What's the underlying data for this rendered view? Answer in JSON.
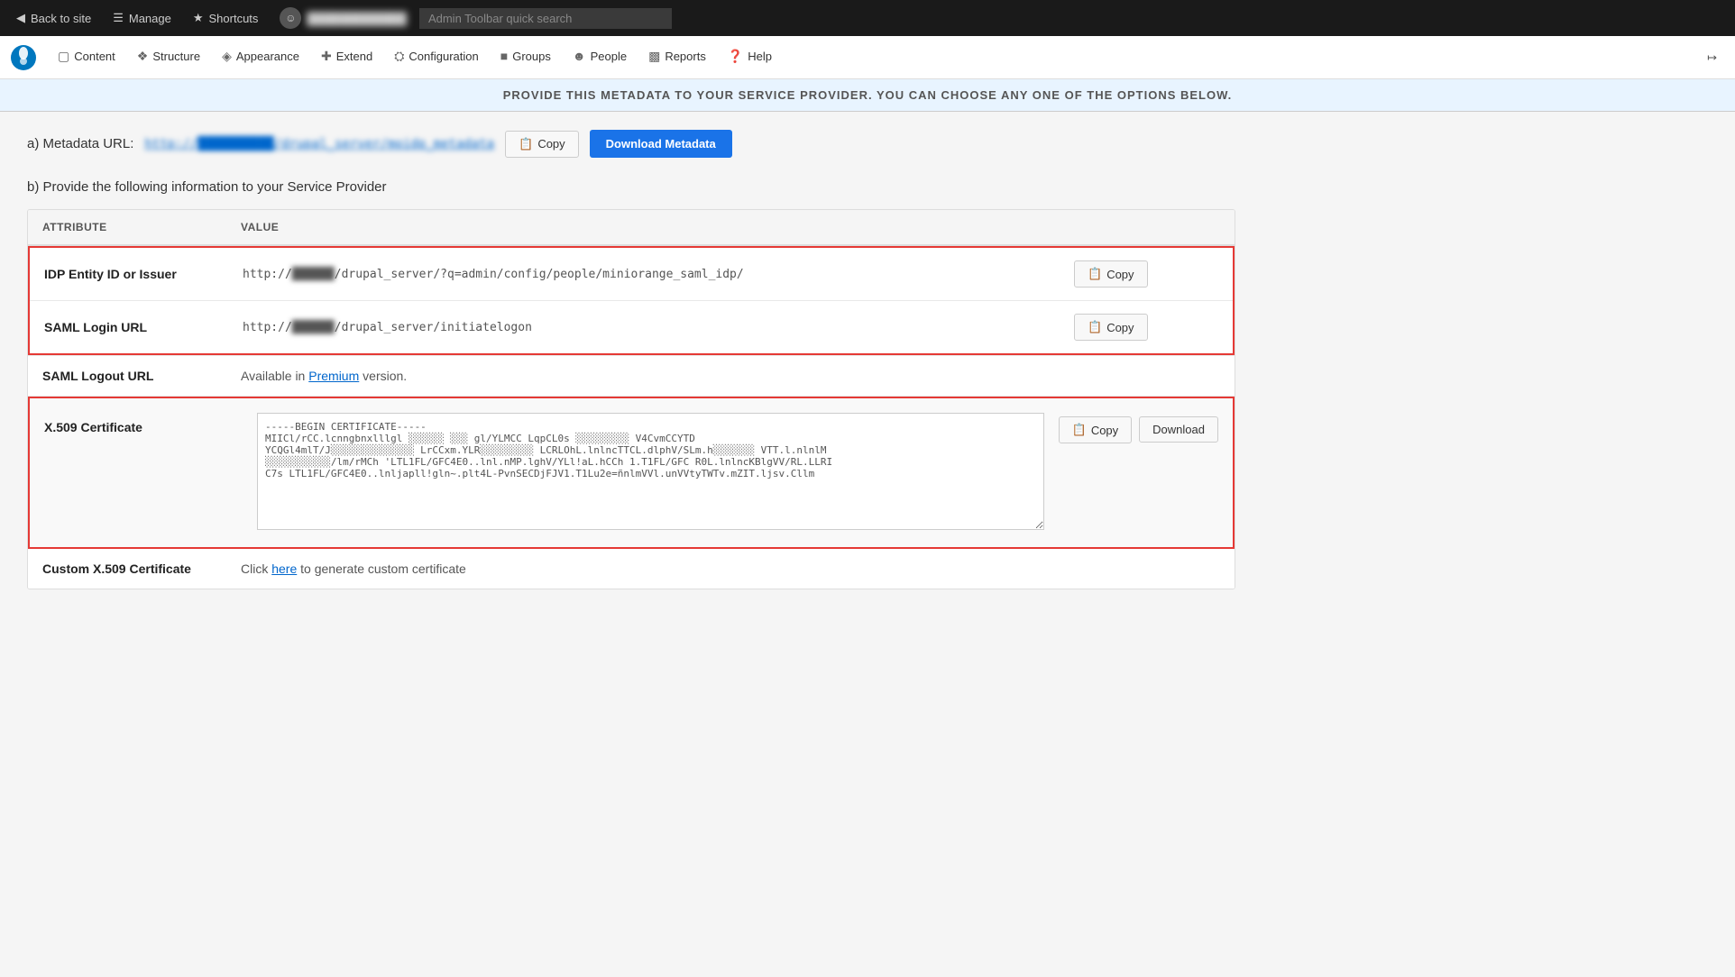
{
  "toolbar": {
    "back_to_site": "Back to site",
    "manage": "Manage",
    "shortcuts": "Shortcuts",
    "user_name": "████████████",
    "search_placeholder": "Admin Toolbar quick search"
  },
  "nav": {
    "content": "Content",
    "structure": "Structure",
    "appearance": "Appearance",
    "extend": "Extend",
    "configuration": "Configuration",
    "groups": "Groups",
    "people": "People",
    "reports": "Reports",
    "help": "Help"
  },
  "banner": {
    "text": "PROVIDE THIS METADATA TO YOUR SERVICE PROVIDER. YOU CAN CHOOSE ANY ONE OF THE OPTIONS BELOW."
  },
  "metadata_section": {
    "label": "a) Metadata URL:",
    "url": "http://██████████/drupal_server/moidp_metadata",
    "copy_btn": "Copy",
    "download_btn": "Download Metadata"
  },
  "section_b": {
    "label": "b) Provide the following information to your Service Provider"
  },
  "table": {
    "col_attribute": "ATTRIBUTE",
    "col_value": "VALUE",
    "rows": [
      {
        "attribute": "IDP Entity ID or Issuer",
        "value": "http://██████/drupal_server/?q=admin/config/people/miniorange_saml_idp/",
        "copy_btn": "Copy",
        "highlight": true
      },
      {
        "attribute": "SAML Login URL",
        "value": "http://██████/drupal_server/initiatelogon",
        "copy_btn": "Copy",
        "highlight": true
      }
    ]
  },
  "logout_row": {
    "attribute": "SAML Logout URL",
    "value_prefix": "Available in ",
    "value_link": "Premium",
    "value_suffix": " version."
  },
  "certificate": {
    "attribute": "X.509 Certificate",
    "content_lines": [
      "-----BEGIN CERTIFICATE-----",
      "MIICl/rCC.lcnngbnxlllgl ░░░░░░░░░ ░░░ gl/YLMCC LqpCL0s ░░░░░░░░░░ V4Cvm CCYT D",
      "YCQGl4mlT /J ░░░░░░░░░░ LrCCxm.YLR ░░░░░░░░░ LCRLOhL.lnlncT TCL.d lphV/SLm.h░░░░░░░ VTT.l.nlnlM",
      "░░░░░░░ /lm/rMCh 'L T L1FL/G F C4E0..ln l.nMP. lghV/YL l!aL.hCCh 1.T1FL/G FCR0L.lnlncKBlgVV/RL.LLRI",
      "C7s L T L1FL/G F C4E0..lnljapll!gln~.plt4L-PvnSECDjFJV1.T1Lu2e=ñnlmVVl.unVVtyTWTv.mZIT.ljsv.Cllm"
    ],
    "copy_btn": "Copy",
    "download_btn": "Download"
  },
  "custom_cert": {
    "attribute": "Custom X.509 Certificate",
    "value_prefix": "Click ",
    "value_link": "here",
    "value_suffix": " to generate custom certificate"
  }
}
